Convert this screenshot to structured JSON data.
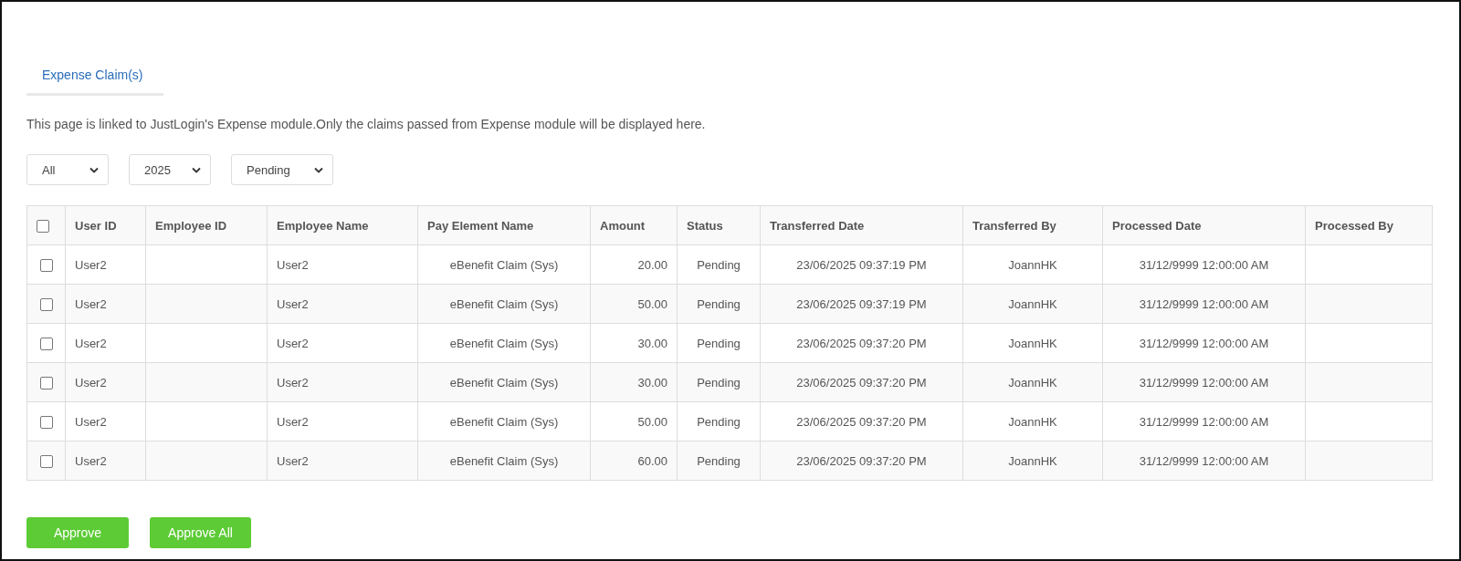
{
  "tabs": [
    {
      "label": "Expense Claim(s)",
      "selected": true
    }
  ],
  "notice": "This page is linked to JustLogin's Expense module.Only the claims passed from Expense module will be displayed here.",
  "filters": [
    {
      "value": "All"
    },
    {
      "value": "2025"
    },
    {
      "value": "Pending"
    }
  ],
  "table": {
    "select_all_checked": false,
    "columns": [
      {
        "label": "User ID"
      },
      {
        "label": "Employee ID"
      },
      {
        "label": "Employee Name"
      },
      {
        "label": "Pay Element Name"
      },
      {
        "label": "Amount"
      },
      {
        "label": "Status"
      },
      {
        "label": "Transferred Date"
      },
      {
        "label": "Transferred By"
      },
      {
        "label": "Processed Date"
      },
      {
        "label": "Processed By"
      }
    ],
    "rows": [
      {
        "checked": false,
        "cells": [
          "User2",
          "",
          "User2",
          "eBenefit Claim (Sys)",
          "20.00",
          "Pending",
          "23/06/2025 09:37:19 PM",
          "JoannHK",
          "31/12/9999 12:00:00 AM",
          ""
        ]
      },
      {
        "checked": false,
        "cells": [
          "User2",
          "",
          "User2",
          "eBenefit Claim (Sys)",
          "50.00",
          "Pending",
          "23/06/2025 09:37:19 PM",
          "JoannHK",
          "31/12/9999 12:00:00 AM",
          ""
        ]
      },
      {
        "checked": false,
        "cells": [
          "User2",
          "",
          "User2",
          "eBenefit Claim (Sys)",
          "30.00",
          "Pending",
          "23/06/2025 09:37:20 PM",
          "JoannHK",
          "31/12/9999 12:00:00 AM",
          ""
        ]
      },
      {
        "checked": false,
        "cells": [
          "User2",
          "",
          "User2",
          "eBenefit Claim (Sys)",
          "30.00",
          "Pending",
          "23/06/2025 09:37:20 PM",
          "JoannHK",
          "31/12/9999 12:00:00 AM",
          ""
        ]
      },
      {
        "checked": false,
        "cells": [
          "User2",
          "",
          "User2",
          "eBenefit Claim (Sys)",
          "50.00",
          "Pending",
          "23/06/2025 09:37:20 PM",
          "JoannHK",
          "31/12/9999 12:00:00 AM",
          ""
        ]
      },
      {
        "checked": false,
        "cells": [
          "User2",
          "",
          "User2",
          "eBenefit Claim (Sys)",
          "60.00",
          "Pending",
          "23/06/2025 09:37:20 PM",
          "JoannHK",
          "31/12/9999 12:00:00 AM",
          ""
        ]
      }
    ]
  },
  "buttons": [
    {
      "label": "Approve"
    },
    {
      "label": "Approve All"
    }
  ]
}
